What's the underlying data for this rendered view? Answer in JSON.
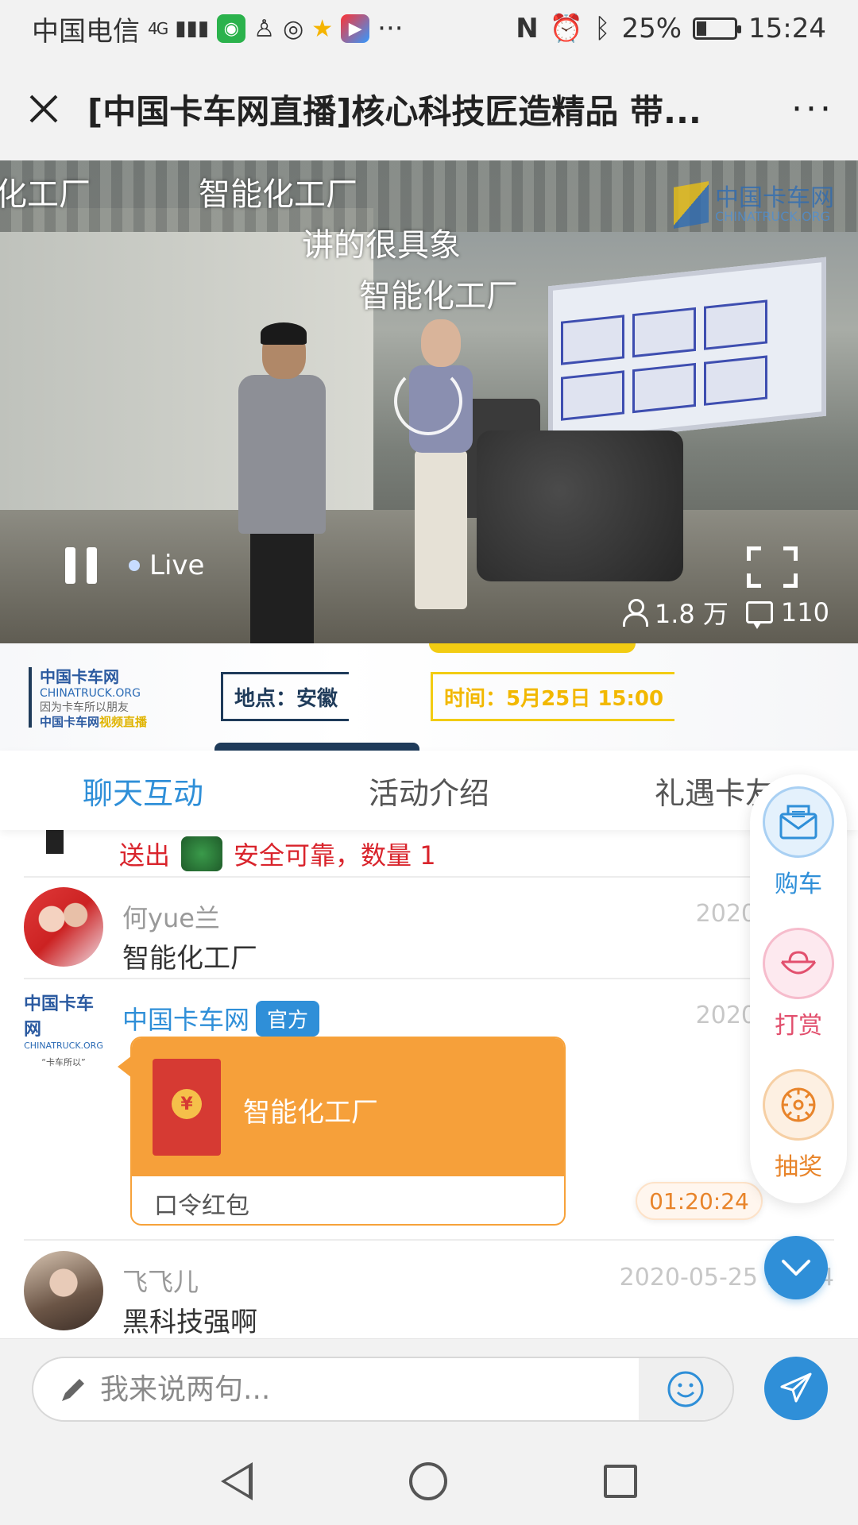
{
  "status_bar": {
    "carrier": "中国电信",
    "network": "4G",
    "more": "···",
    "battery": "25%",
    "battery_level": 0.25,
    "time": "15:24"
  },
  "header": {
    "title": "[中国卡车网直播]核心科技匠造精品 带...",
    "more": "···"
  },
  "video": {
    "danmu": [
      "化工厂",
      "智能化工厂",
      "讲的很具象",
      "智能化工厂"
    ],
    "watermark": {
      "name": "中国卡车网",
      "domain": "CHINATRUCK.ORG"
    },
    "live_label": "Live",
    "viewers": "1.8 万",
    "comments": "110"
  },
  "banner": {
    "logo_title": "中国卡车网",
    "logo_domain": "CHINATRUCK.ORG",
    "logo_slogan": "因为卡车所以朋友",
    "logo_sub": "中国卡车网",
    "logo_sub_highlight": "视频直播",
    "location": "地点：安徽",
    "time": "时间：5月25日  15:00"
  },
  "tabs": [
    {
      "label": "聊天互动",
      "active": true
    },
    {
      "label": "活动介绍",
      "active": false
    },
    {
      "label": "礼遇卡友",
      "active": false
    }
  ],
  "chat": {
    "gift_line": {
      "prefix": "送出",
      "gift_name": "安全可靠，数量 1"
    },
    "messages": [
      {
        "name": "何yue兰",
        "date": "2020-05-25",
        "text": "智能化工厂"
      },
      {
        "name": "中国卡车网",
        "badge": "官方",
        "date": "2020-05-25",
        "red_packet": {
          "title": "智能化工厂",
          "type": "口令红包",
          "coin": "¥"
        },
        "avatar_lines": [
          "中国卡车网",
          "CHINATRUCK.ORG",
          "“卡车所以”"
        ]
      },
      {
        "name": "飞飞儿",
        "date": "2020-05-25 15:24",
        "text": "黑科技强啊"
      }
    ]
  },
  "timer": "01:20:24",
  "fab": {
    "buy": "购车",
    "tip": "打赏",
    "lottery": "抽奖"
  },
  "input": {
    "placeholder": "我来说两句..."
  },
  "colors": {
    "accent": "#2f8fd8",
    "red_packet": "#f6a03a",
    "gift_red": "#d9242c",
    "banner_navy": "#1f3b5a",
    "banner_yellow": "#f2cc13"
  }
}
